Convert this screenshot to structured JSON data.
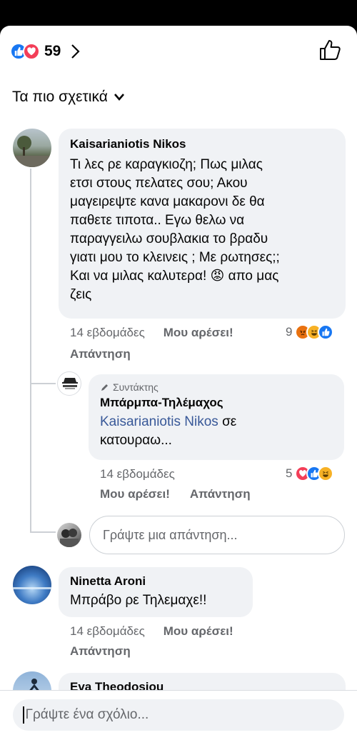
{
  "header": {
    "reaction_count": "59",
    "sort_label": "Τα πιο σχετικά"
  },
  "comments": [
    {
      "author": "Kaisarianiotis Nikos",
      "lines": [
        "Τι λες ρε καραγκιοζη; Πως μιλας",
        "ετσι στους πελατες σου; Ακου",
        "μαγειρεψτε κανα μακαρονι δε θα",
        "παθετε τιποτα.. Εγω θελω να",
        "παραγγειλω σουβλακια το βραδυ",
        "γιατι μου το κλεινεις ; Με ρωτησες;;",
        "Και να μιλας καλυτερα! 😡 απο μας",
        "ζεις"
      ],
      "time": "14 εβδομάδες",
      "like_label": "Μου αρέσει!",
      "reply_label": "Απάντηση",
      "reaction_count": "9",
      "reactions": [
        "angry-icon",
        "haha-icon",
        "like-icon"
      ]
    },
    {
      "badge": "Συντάκτης",
      "author": "Μπάρμπα-Τηλέμαχος",
      "mention": "Kaisarianiotis Nikos",
      "text_after_mention": "σε",
      "line2": "κατουραω...",
      "time": "14 εβδομάδες",
      "like_label": "Μου αρέσει!",
      "reply_label": "Απάντηση",
      "reaction_count": "5",
      "reactions": [
        "love-icon",
        "like-icon",
        "haha-icon"
      ]
    },
    {
      "author": "Ninetta Aroni",
      "text": "Μπράβο ρε Τηλεμαχε!!",
      "time": "14 εβδομάδες",
      "like_label": "Μου αρέσει!",
      "reply_label": "Απάντηση"
    },
    {
      "author": "Eva Theodosiou"
    }
  ],
  "reply_box": {
    "placeholder": "Γράψτε μια απάντηση..."
  },
  "comment_box": {
    "placeholder": "Γράψτε ένα σχόλιο..."
  },
  "colors": {
    "like_blue": "#1877f2",
    "love_red": "#f33e58",
    "angry": "#e9710f",
    "haha": "#f7b125",
    "bubble": "#f0f2f5"
  }
}
